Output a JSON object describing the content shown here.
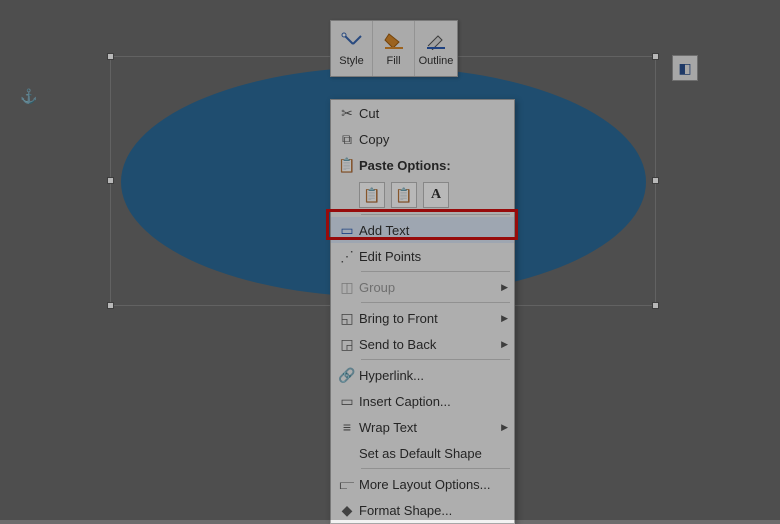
{
  "anchor_icon": "⚓",
  "layout_icon": "◧",
  "mini_toolbar": {
    "style": "Style",
    "fill": "Fill",
    "outline": "Outline"
  },
  "menu": {
    "cut": "Cut",
    "copy": "Copy",
    "paste_options": "Paste Options:",
    "add_text": "Add Text",
    "edit_points": "Edit Points",
    "group": "Group",
    "bring_to_front": "Bring to Front",
    "send_to_back": "Send to Back",
    "hyperlink": "Hyperlink...",
    "insert_caption": "Insert Caption...",
    "wrap_text": "Wrap Text",
    "set_default": "Set as Default Shape",
    "more_layout": "More Layout Options...",
    "format_shape": "Format Shape..."
  }
}
